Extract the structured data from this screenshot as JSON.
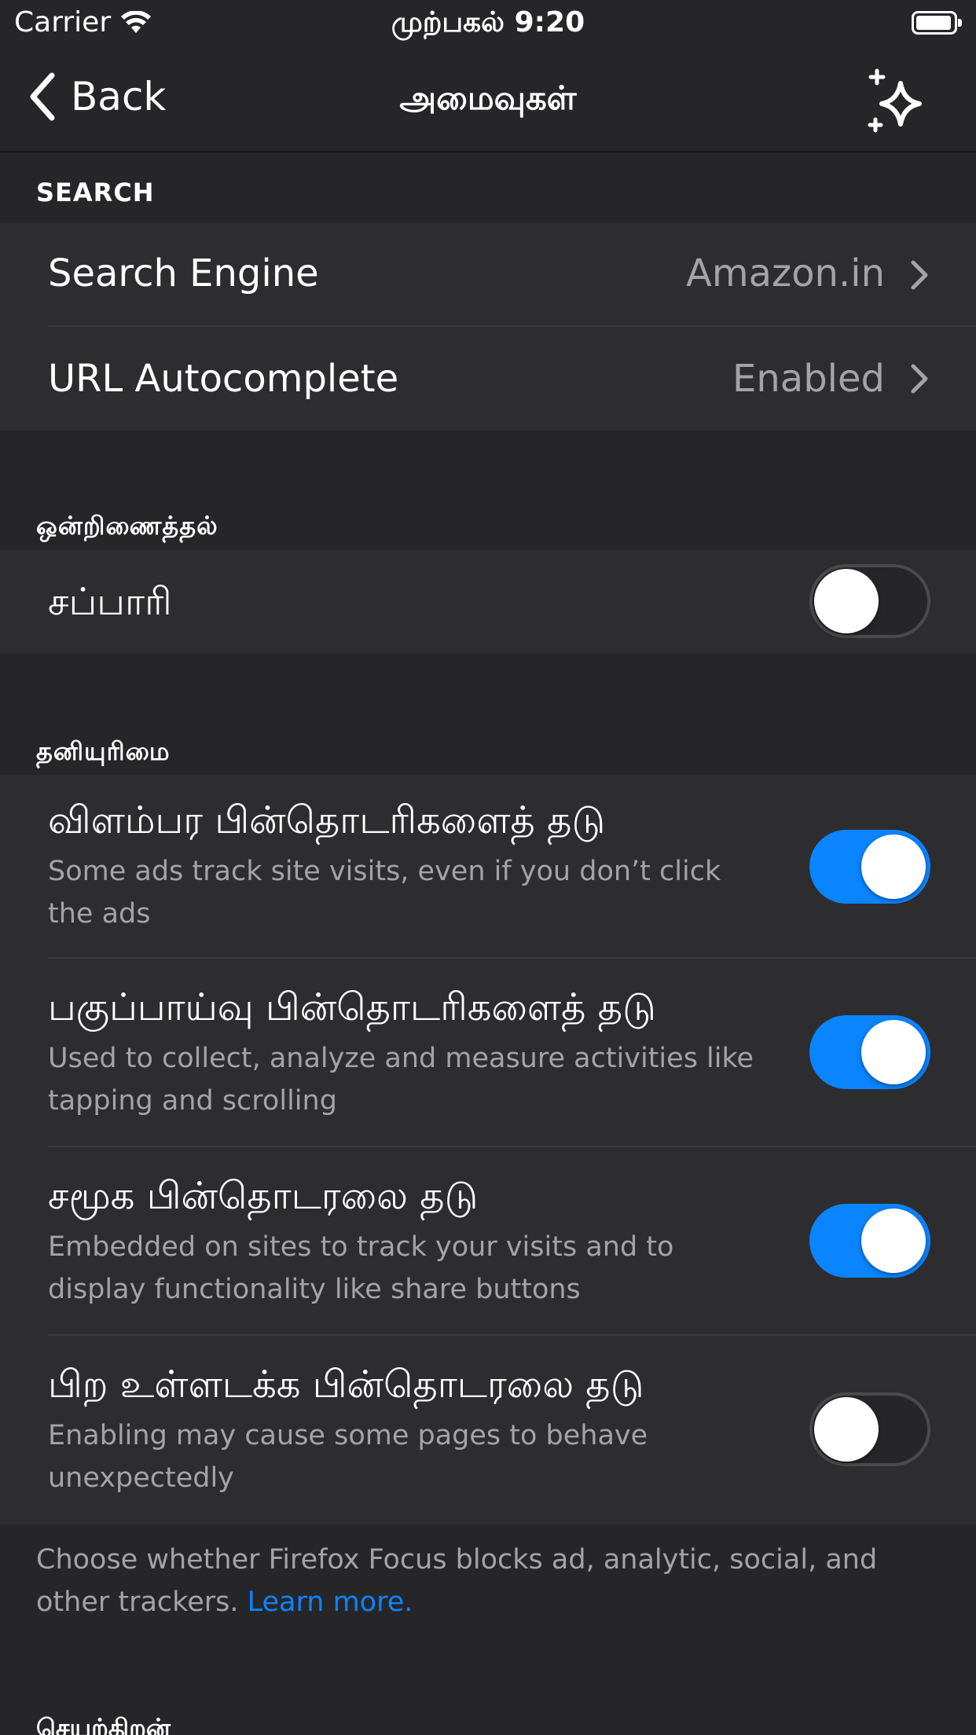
{
  "status_bar": {
    "carrier": "Carrier",
    "time": "முற்பகல் 9:20"
  },
  "nav": {
    "back_label": "Back",
    "title": "அமைவுகள்",
    "whats_new_icon": "sparkle-icon"
  },
  "search_section": {
    "header": "SEARCH",
    "rows": [
      {
        "title": "Search Engine",
        "value": "Amazon.in"
      },
      {
        "title": "URL Autocomplete",
        "value": "Enabled"
      }
    ]
  },
  "integration_section": {
    "header": "ஒன்றிணைத்தல்",
    "rows": [
      {
        "title": "சப்பாரி",
        "enabled": false
      }
    ]
  },
  "privacy_section": {
    "header": "தனியுரிமை",
    "rows": [
      {
        "title": "விளம்பர பின்தொடரிகளைத் தடு",
        "subtitle": "Some ads track site visits, even if you don’t click the ads",
        "enabled": true
      },
      {
        "title": "பகுப்பாய்வு பின்தொடரிகளைத் தடு",
        "subtitle": "Used to collect, analyze and measure activities like tapping and scrolling",
        "enabled": true
      },
      {
        "title": "சமூக பின்தொடரலை தடு",
        "subtitle": "Embedded on sites to track your visits and to display functionality like share buttons",
        "enabled": true
      },
      {
        "title": "பிற உள்ளடக்க பின்தொடரலை தடு",
        "subtitle": "Enabling may cause some pages to behave unexpectedly",
        "enabled": false
      }
    ],
    "footer_text": "Choose whether Firefox Focus blocks ad, analytic, social, and other trackers.",
    "footer_link": "Learn more."
  },
  "next_section_header": "செயற்திறன்",
  "colors": {
    "background": "#262628",
    "cell": "#2d2d30",
    "accent": "#0a84ff",
    "secondary_text": "#a3a3a8"
  }
}
